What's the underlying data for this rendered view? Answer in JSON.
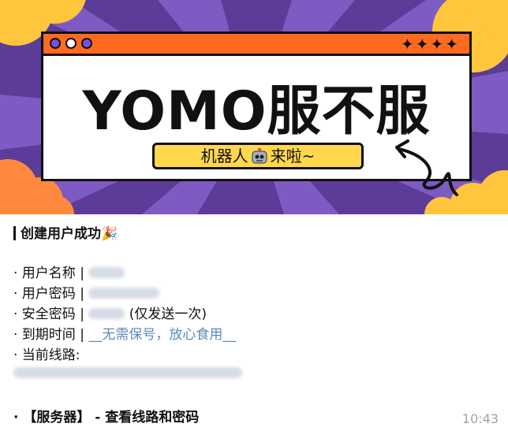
{
  "banner": {
    "headline": "YOMO服不服",
    "pill_text_left": "机器人",
    "pill_text_right": "来啦~",
    "stars": "✦✦✦✦"
  },
  "message": {
    "title": "创建用户成功",
    "title_emoji": "🎉",
    "rows": [
      {
        "label": "· 用户名称 |",
        "value_hidden": true
      },
      {
        "label": "· 用户密码 |",
        "value_hidden": true
      },
      {
        "label": "· 安全密码 |",
        "value_hidden": true,
        "note": "(仅发送一次)"
      },
      {
        "label": "· 到期时间 |",
        "value": "__无需保号，放心食用__"
      },
      {
        "label": "· 当前线路:"
      }
    ],
    "footer": "· 【服务器】 - 查看线路和密码",
    "time": "10:43"
  },
  "colors": {
    "banner_bg": "#5b3c98",
    "titlebar": "#ff6a1f",
    "pill": "#ffd84d",
    "link_blue": "#5b8ab8"
  }
}
